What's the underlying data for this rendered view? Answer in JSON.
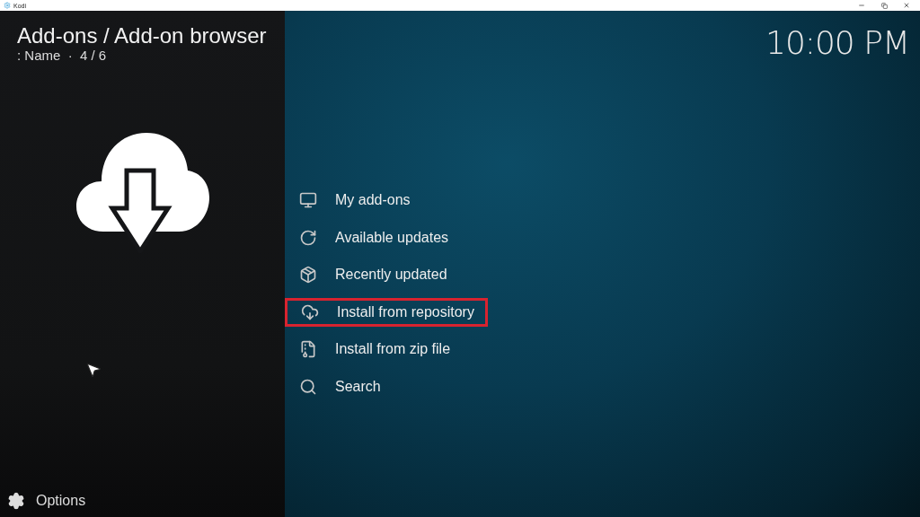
{
  "window": {
    "title": "Kodi"
  },
  "header": {
    "title": "Add-ons / Add-on browser",
    "subtitle": ": Name  ·  4 / 6",
    "clock": "10:00 PM"
  },
  "menu": [
    {
      "label": "My add-ons",
      "selected": false
    },
    {
      "label": "Available updates",
      "selected": false
    },
    {
      "label": "Recently updated",
      "selected": false
    },
    {
      "label": "Install from repository",
      "selected": true
    },
    {
      "label": "Install from zip file",
      "selected": false
    },
    {
      "label": "Search",
      "selected": false
    }
  ],
  "footer": {
    "options": "Options"
  }
}
